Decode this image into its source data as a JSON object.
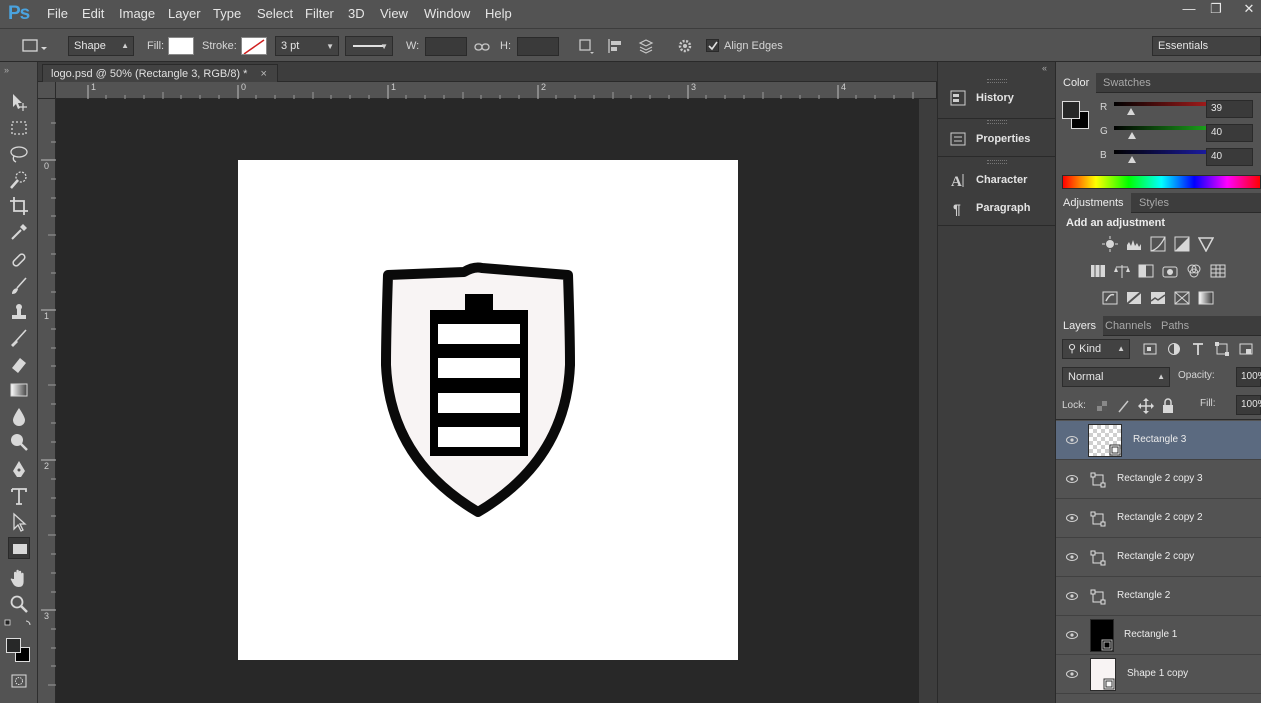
{
  "app": {
    "logo": "Ps"
  },
  "menu": [
    "File",
    "Edit",
    "Image",
    "Layer",
    "Type",
    "Select",
    "Filter",
    "3D",
    "View",
    "Window",
    "Help"
  ],
  "options": {
    "mode_value": "Shape",
    "fill_label": "Fill:",
    "stroke_label": "Stroke:",
    "stroke_width": "3 pt",
    "w_label": "W:",
    "h_label": "H:",
    "align_edges_label": "Align Edges",
    "align_edges_checked": true,
    "workspace": "Essentials"
  },
  "document": {
    "tab_title": "logo.psd @ 50% (Rectangle 3, RGB/8) *",
    "ruler_h": [
      "1",
      "0",
      "1",
      "2",
      "3",
      "4"
    ],
    "ruler_v": [
      "0",
      "1",
      "2",
      "3"
    ]
  },
  "mid_panels": [
    "History",
    "Properties",
    "Character",
    "Paragraph"
  ],
  "color_panel": {
    "tabs": [
      "Color",
      "Swatches"
    ],
    "channels": [
      {
        "label": "R",
        "value": "39",
        "color": "#c02020",
        "level": 0.153
      },
      {
        "label": "G",
        "value": "40",
        "color": "#20c020",
        "level": 0.157
      },
      {
        "label": "B",
        "value": "40",
        "color": "#2020c0",
        "level": 0.157
      }
    ]
  },
  "adjustments_panel": {
    "tabs": [
      "Adjustments",
      "Styles"
    ],
    "heading": "Add an adjustment",
    "icons": [
      "brightness-contrast-icon",
      "levels-icon",
      "curves-icon",
      "exposure-icon",
      "vibrance-icon",
      "hue-saturation-icon",
      "color-balance-icon",
      "black-white-icon",
      "photo-filter-icon",
      "channel-mixer-icon",
      "color-lookup-icon",
      "invert-icon",
      "posterize-icon",
      "threshold-icon",
      "selective-color-icon",
      "gradient-map-icon"
    ]
  },
  "layers_panel": {
    "tabs": [
      "Layers",
      "Channels",
      "Paths"
    ],
    "filter_kind": "Kind",
    "blend_mode": "Normal",
    "opacity_label": "Opacity:",
    "opacity_value": "100%",
    "lock_label": "Lock:",
    "fill_label": "Fill:",
    "fill_value": "100%",
    "layers": [
      {
        "name": "Rectangle 3",
        "selected": true
      },
      {
        "name": "Rectangle 2 copy 3",
        "selected": false
      },
      {
        "name": "Rectangle 2 copy 2",
        "selected": false
      },
      {
        "name": "Rectangle 2 copy",
        "selected": false
      },
      {
        "name": "Rectangle 2",
        "selected": false
      },
      {
        "name": "Rectangle 1",
        "selected": false
      },
      {
        "name": "Shape 1 copy",
        "selected": false
      }
    ]
  }
}
